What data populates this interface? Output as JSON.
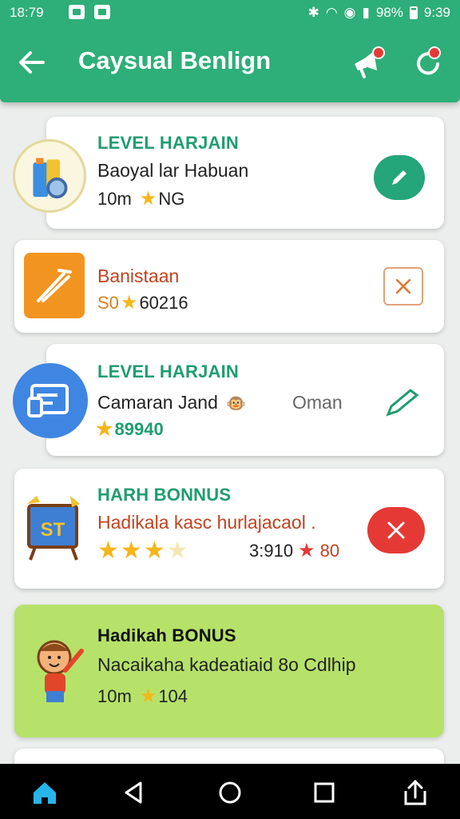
{
  "status_bar": {
    "time": "18:79",
    "battery": "98%",
    "clock": "9:39"
  },
  "app_bar": {
    "title": "Caysual Benlign"
  },
  "cards": [
    {
      "title": "LEVEL HARJAIN",
      "subtitle": "Baoyal lar Habuan",
      "meta_prefix": "10m",
      "meta_suffix": "NG",
      "icon": "suitcase-icon",
      "action_icon": "pencil-icon",
      "action_color": "#24a57a"
    },
    {
      "subtitle": "Banistaan",
      "meta_prefix": "S0",
      "meta_suffix": "60216",
      "icon": "tools-icon",
      "action_icon": "close-icon",
      "action_color": "#e08a4a"
    },
    {
      "title": "LEVEL HARJAIN",
      "subtitle": "Camaran Jand",
      "side_text": "Oman",
      "meta_suffix": "89940",
      "icon": "chat-window-icon",
      "action_icon": "pencil-icon",
      "action_color": "#1f9d70"
    },
    {
      "title": "HARH BONNUS",
      "subtitle": "Hadikala kasc hurlajacaol .",
      "rating": 3,
      "rating_max": 4,
      "score_left": "3:910",
      "score_right": "80",
      "icon": "easel-icon",
      "action_icon": "close-icon",
      "action_color": "#e53935"
    },
    {
      "title": "Hadikah BONUS",
      "subtitle": "Nacaikaha kadeatiaid 8o Cdlhip",
      "meta_prefix": "10m",
      "meta_suffix": "104",
      "icon": "mascot-icon",
      "background": "#b6e26a"
    }
  ],
  "nav": [
    "home-icon",
    "back-triangle-icon",
    "circle-home-icon",
    "square-recents-icon",
    "share-icon"
  ]
}
